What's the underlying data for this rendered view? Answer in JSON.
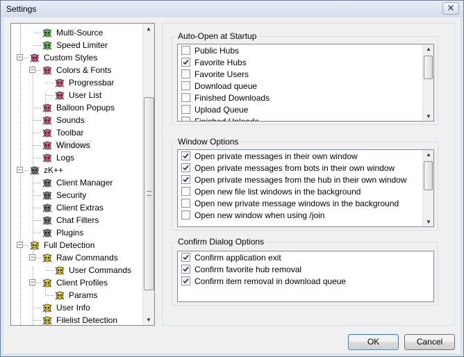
{
  "window": {
    "title": "Settings",
    "close_glyph": "✕"
  },
  "tree": {
    "items": [
      {
        "label": "Multi-Source",
        "level": 2,
        "icon": "green-skull-icon",
        "expander": ""
      },
      {
        "label": "Speed Limiter",
        "level": 2,
        "icon": "green-skull-icon",
        "expander": ""
      },
      {
        "label": "Custom Styles",
        "level": 1,
        "icon": "pink-skull-icon",
        "expander": "−"
      },
      {
        "label": "Colors & Fonts",
        "level": 2,
        "icon": "pink-skull-icon",
        "expander": "−"
      },
      {
        "label": "Progressbar",
        "level": 3,
        "icon": "pink-skull-icon",
        "expander": ""
      },
      {
        "label": "User List",
        "level": 3,
        "icon": "pink-skull-icon",
        "expander": ""
      },
      {
        "label": "Balloon Popups",
        "level": 2,
        "icon": "pink-skull-icon",
        "expander": ""
      },
      {
        "label": "Sounds",
        "level": 2,
        "icon": "pink-skull-icon",
        "expander": ""
      },
      {
        "label": "Toolbar",
        "level": 2,
        "icon": "pink-skull-icon",
        "expander": ""
      },
      {
        "label": "Windows",
        "level": 2,
        "icon": "pink-skull-icon",
        "expander": "",
        "selected": true
      },
      {
        "label": "Logs",
        "level": 2,
        "icon": "pink-skull-icon",
        "expander": ""
      },
      {
        "label": "zK++",
        "level": 1,
        "icon": "grey-skull-icon",
        "expander": "−"
      },
      {
        "label": "Client Manager",
        "level": 2,
        "icon": "grey-skull-icon",
        "expander": ""
      },
      {
        "label": "Security",
        "level": 2,
        "icon": "grey-skull-icon",
        "expander": ""
      },
      {
        "label": "Client Extras",
        "level": 2,
        "icon": "grey-skull-icon",
        "expander": ""
      },
      {
        "label": "Chat Filters",
        "level": 2,
        "icon": "grey-skull-icon",
        "expander": ""
      },
      {
        "label": "Plugins",
        "level": 2,
        "icon": "grey-skull-icon",
        "expander": ""
      },
      {
        "label": "Full Detection",
        "level": 1,
        "icon": "yellow-skull-icon",
        "expander": "−"
      },
      {
        "label": "Raw Commands",
        "level": 2,
        "icon": "yellow-skull-icon",
        "expander": "−"
      },
      {
        "label": "User Commands",
        "level": 3,
        "icon": "yellow-skull-icon",
        "expander": ""
      },
      {
        "label": "Client Profiles",
        "level": 2,
        "icon": "yellow-skull-icon",
        "expander": "−"
      },
      {
        "label": "Params",
        "level": 3,
        "icon": "yellow-skull-icon",
        "expander": ""
      },
      {
        "label": "User Info",
        "level": 2,
        "icon": "yellow-skull-icon",
        "expander": ""
      },
      {
        "label": "Filelist Detection",
        "level": 2,
        "icon": "yellow-skull-icon",
        "expander": ""
      }
    ]
  },
  "auto_open": {
    "title": "Auto-Open at Startup",
    "items": [
      {
        "label": "Public Hubs",
        "checked": false
      },
      {
        "label": "Favorite Hubs",
        "checked": true
      },
      {
        "label": "Favorite Users",
        "checked": false
      },
      {
        "label": "Download queue",
        "checked": false
      },
      {
        "label": "Finished Downloads",
        "checked": false
      },
      {
        "label": "Upload Queue",
        "checked": false
      },
      {
        "label": "Finished Uploads",
        "checked": false
      }
    ]
  },
  "window_options": {
    "title": "Window Options",
    "items": [
      {
        "label": "Open private messages in their own window",
        "checked": true
      },
      {
        "label": "Open private messages from bots in their own window",
        "checked": true
      },
      {
        "label": "Open private messages from the hub in their own window",
        "checked": true
      },
      {
        "label": "Open new file list windows in the background",
        "checked": false
      },
      {
        "label": "Open new private message windows in the background",
        "checked": false
      },
      {
        "label": "Open new window when using /join",
        "checked": false
      }
    ]
  },
  "confirm_options": {
    "title": "Confirm Dialog Options",
    "items": [
      {
        "label": "Confirm application exit",
        "checked": true
      },
      {
        "label": "Confirm favorite hub removal",
        "checked": true
      },
      {
        "label": "Confirm item removal in download queue",
        "checked": true
      }
    ]
  },
  "buttons": {
    "ok": "OK",
    "cancel": "Cancel"
  },
  "icon_colors": {
    "green": "#59c23a",
    "pink": "#e0578f",
    "grey": "#7a7a7a",
    "yellow": "#e6d21a"
  }
}
